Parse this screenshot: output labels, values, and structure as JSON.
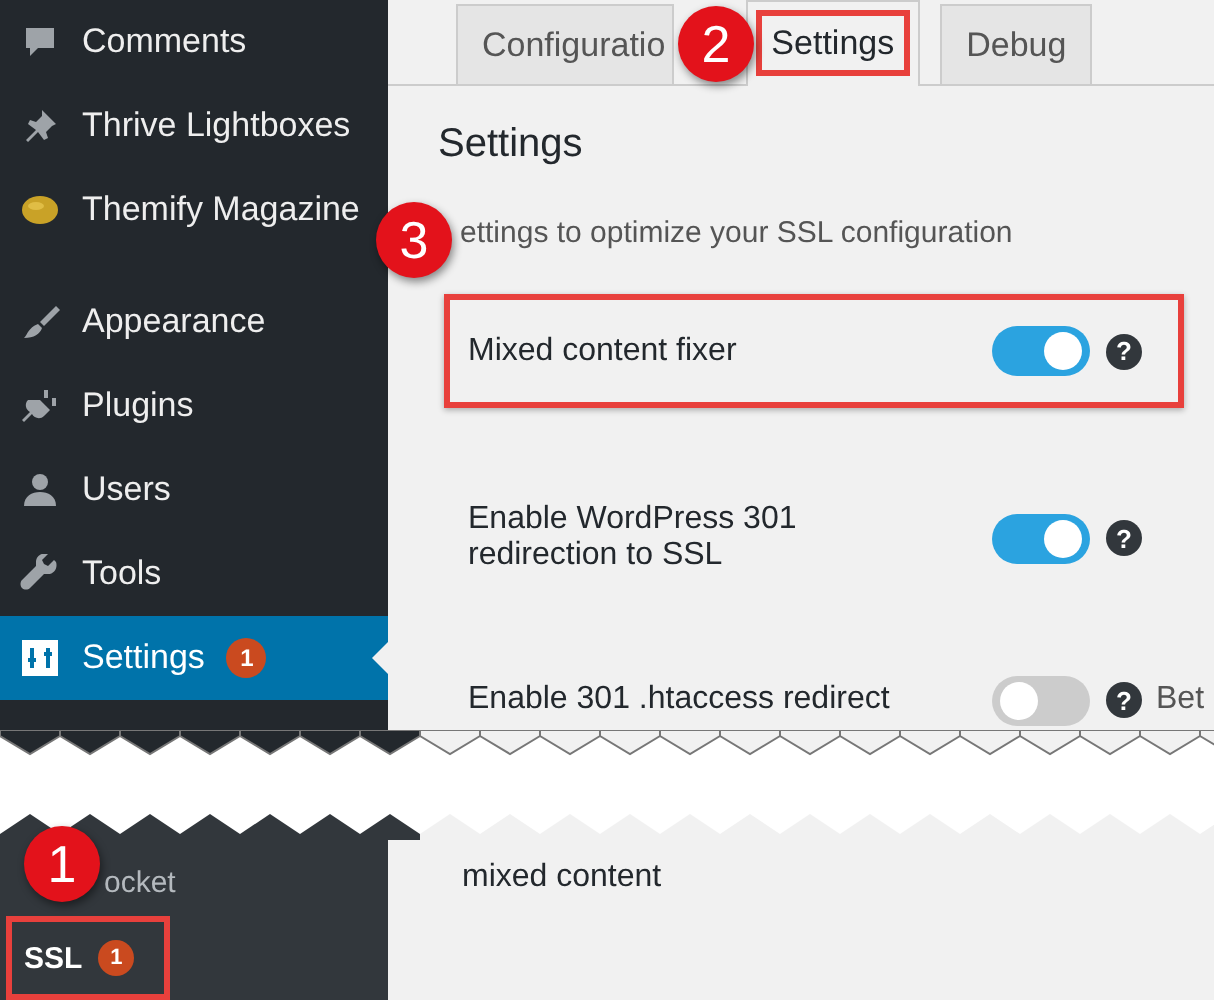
{
  "sidebar": {
    "items": [
      {
        "label": "Comments",
        "selected": false
      },
      {
        "label": "Thrive Lightboxes",
        "selected": false
      },
      {
        "label": "Themify Magazine",
        "selected": false
      },
      {
        "label": "Appearance",
        "selected": false
      },
      {
        "label": "Plugins",
        "selected": false
      },
      {
        "label": "Users",
        "selected": false
      },
      {
        "label": "Tools",
        "selected": false
      },
      {
        "label": "Settings",
        "selected": true,
        "badge": "1"
      }
    ],
    "submenu": [
      {
        "label": "ocket",
        "selected": false
      },
      {
        "label": "SSL",
        "selected": true,
        "badge": "1",
        "highlighted": true
      }
    ]
  },
  "tabs": [
    {
      "label": "Configuratio",
      "selected": false,
      "highlighted": false
    },
    {
      "label": "Settings",
      "selected": true,
      "highlighted": true
    },
    {
      "label": "Debug",
      "selected": false,
      "highlighted": false
    }
  ],
  "settings": {
    "title": "Settings",
    "description": "ettings to optimize your SSL configuration",
    "rows": [
      {
        "label": "Mixed content fixer",
        "on": true,
        "help": "?",
        "highlighted": true
      },
      {
        "label": "Enable WordPress 301 redirection to SSL",
        "on": true,
        "help": "?"
      },
      {
        "label": "Enable 301 .htaccess redirect",
        "on": false,
        "help": "?",
        "note": "Bet"
      }
    ],
    "lower_rows": [
      {
        "label": "mixed content"
      }
    ]
  },
  "callouts": [
    {
      "number": "1"
    },
    {
      "number": "2"
    },
    {
      "number": "3"
    }
  ]
}
